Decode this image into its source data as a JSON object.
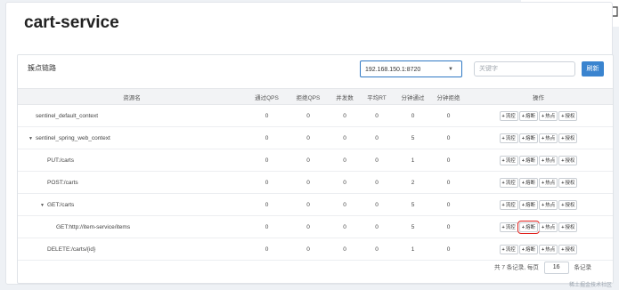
{
  "page": {
    "title": "cart-service"
  },
  "panel": {
    "title": "簇点链路",
    "machine": "192.168.150.1:8720",
    "search_placeholder": "关键字",
    "refresh_label": "刷新"
  },
  "table": {
    "headers": [
      "资源名",
      "通过QPS",
      "拒绝QPS",
      "并发数",
      "平均RT",
      "分钟通过",
      "分钟拒绝",
      "操作"
    ],
    "op_labels": [
      "流控",
      "熔断",
      "热点",
      "授权"
    ],
    "rows": [
      {
        "name": "sentinel_default_context",
        "depth": 0,
        "expandable": false,
        "values": [
          "0",
          "0",
          "0",
          "0",
          "0",
          "0"
        ]
      },
      {
        "name": "sentinel_spring_web_context",
        "depth": 0,
        "expandable": true,
        "values": [
          "0",
          "0",
          "0",
          "0",
          "5",
          "0"
        ]
      },
      {
        "name": "PUT:/carts",
        "depth": 1,
        "expandable": false,
        "values": [
          "0",
          "0",
          "0",
          "0",
          "1",
          "0"
        ]
      },
      {
        "name": "POST:/carts",
        "depth": 1,
        "expandable": false,
        "values": [
          "0",
          "0",
          "0",
          "0",
          "2",
          "0"
        ]
      },
      {
        "name": "GET:/carts",
        "depth": 1,
        "expandable": true,
        "values": [
          "0",
          "0",
          "0",
          "0",
          "5",
          "0"
        ]
      },
      {
        "name": "GET:http://item-service/items",
        "depth": 2,
        "expandable": false,
        "values": [
          "0",
          "0",
          "0",
          "0",
          "5",
          "0"
        ],
        "highlight_op": 1
      },
      {
        "name": "DELETE:/carts/{id}",
        "depth": 1,
        "expandable": false,
        "values": [
          "0",
          "0",
          "0",
          "0",
          "1",
          "0"
        ]
      }
    ]
  },
  "pager": {
    "summary": "共 7 条记录, 每页",
    "page_size": "16",
    "suffix": "条记录"
  },
  "watermark": "稀土掘金技术社区",
  "icons": {
    "grid": "grid-icon",
    "wrap": "text-wrap-icon",
    "comment": "comment-icon"
  }
}
